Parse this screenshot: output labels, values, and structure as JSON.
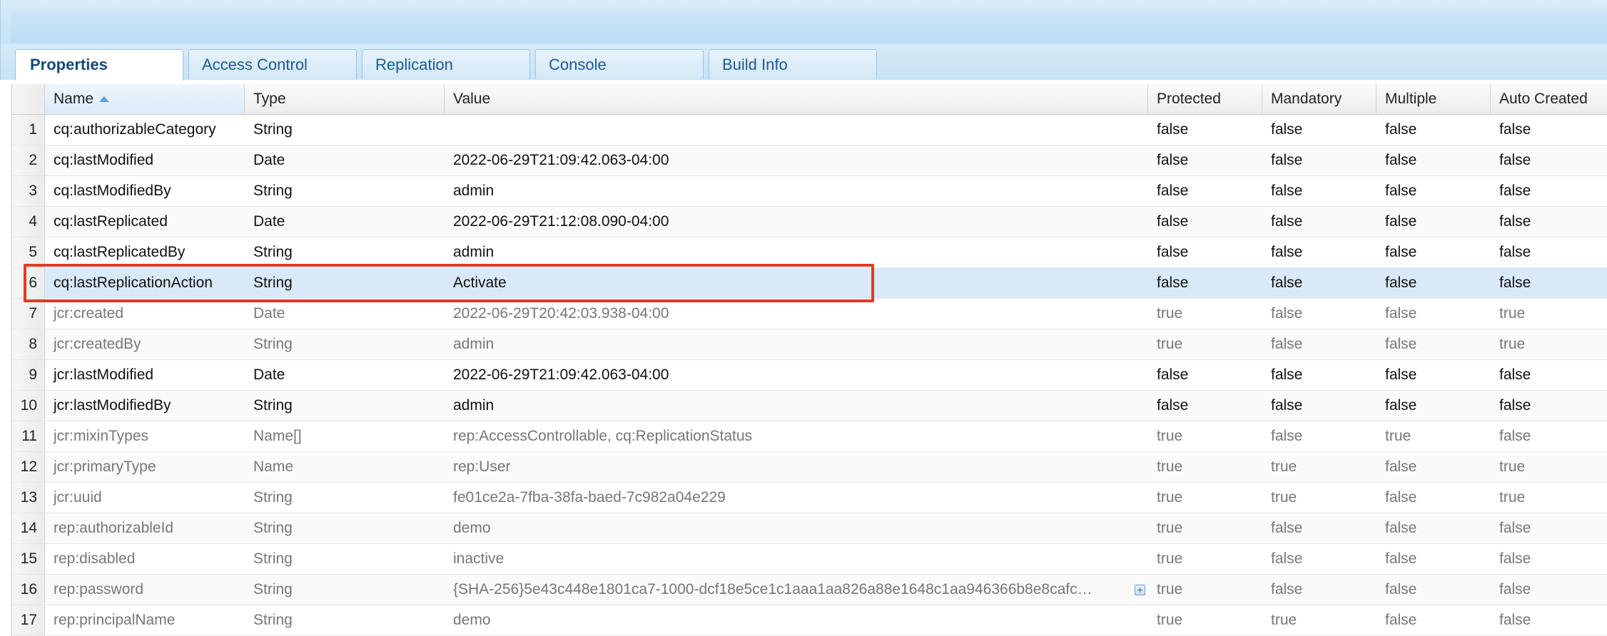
{
  "tabs": [
    {
      "label": "Properties",
      "active": true
    },
    {
      "label": "Access Control",
      "active": false
    },
    {
      "label": "Replication",
      "active": false
    },
    {
      "label": "Console",
      "active": false
    },
    {
      "label": "Build Info",
      "active": false
    }
  ],
  "columns": {
    "name": "Name",
    "type": "Type",
    "value": "Value",
    "protected": "Protected",
    "mandatory": "Mandatory",
    "multiple": "Multiple",
    "auto_created": "Auto Created"
  },
  "sort": {
    "column": "Name",
    "direction": "ascending"
  },
  "rows": [
    {
      "num": "1",
      "name": "cq:authorizableCategory",
      "type": "String",
      "value": "",
      "protected": "false",
      "mandatory": "false",
      "multiple": "false",
      "auto_created": "false"
    },
    {
      "num": "2",
      "name": "cq:lastModified",
      "type": "Date",
      "value": "2022-06-29T21:09:42.063-04:00",
      "protected": "false",
      "mandatory": "false",
      "multiple": "false",
      "auto_created": "false"
    },
    {
      "num": "3",
      "name": "cq:lastModifiedBy",
      "type": "String",
      "value": "admin",
      "protected": "false",
      "mandatory": "false",
      "multiple": "false",
      "auto_created": "false"
    },
    {
      "num": "4",
      "name": "cq:lastReplicated",
      "type": "Date",
      "value": "2022-06-29T21:12:08.090-04:00",
      "protected": "false",
      "mandatory": "false",
      "multiple": "false",
      "auto_created": "false"
    },
    {
      "num": "5",
      "name": "cq:lastReplicatedBy",
      "type": "String",
      "value": "admin",
      "protected": "false",
      "mandatory": "false",
      "multiple": "false",
      "auto_created": "false"
    },
    {
      "num": "6",
      "name": "cq:lastReplicationAction",
      "type": "String",
      "value": "Activate",
      "protected": "false",
      "mandatory": "false",
      "multiple": "false",
      "auto_created": "false"
    },
    {
      "num": "7",
      "name": "jcr:created",
      "type": "Date",
      "value": "2022-06-29T20:42:03.938-04:00",
      "protected": "true",
      "mandatory": "false",
      "multiple": "false",
      "auto_created": "true"
    },
    {
      "num": "8",
      "name": "jcr:createdBy",
      "type": "String",
      "value": "admin",
      "protected": "true",
      "mandatory": "false",
      "multiple": "false",
      "auto_created": "true"
    },
    {
      "num": "9",
      "name": "jcr:lastModified",
      "type": "Date",
      "value": "2022-06-29T21:09:42.063-04:00",
      "protected": "false",
      "mandatory": "false",
      "multiple": "false",
      "auto_created": "false"
    },
    {
      "num": "10",
      "name": "jcr:lastModifiedBy",
      "type": "String",
      "value": "admin",
      "protected": "false",
      "mandatory": "false",
      "multiple": "false",
      "auto_created": "false"
    },
    {
      "num": "11",
      "name": "jcr:mixinTypes",
      "type": "Name[]",
      "value": "rep:AccessControllable, cq:ReplicationStatus",
      "protected": "true",
      "mandatory": "false",
      "multiple": "true",
      "auto_created": "false"
    },
    {
      "num": "12",
      "name": "jcr:primaryType",
      "type": "Name",
      "value": "rep:User",
      "protected": "true",
      "mandatory": "true",
      "multiple": "false",
      "auto_created": "true"
    },
    {
      "num": "13",
      "name": "jcr:uuid",
      "type": "String",
      "value": "fe01ce2a-7fba-38fa-baed-7c982a04e229",
      "protected": "true",
      "mandatory": "true",
      "multiple": "false",
      "auto_created": "true"
    },
    {
      "num": "14",
      "name": "rep:authorizableId",
      "type": "String",
      "value": "demo",
      "protected": "true",
      "mandatory": "false",
      "multiple": "false",
      "auto_created": "false"
    },
    {
      "num": "15",
      "name": "rep:disabled",
      "type": "String",
      "value": "inactive",
      "protected": "true",
      "mandatory": "false",
      "multiple": "false",
      "auto_created": "false"
    },
    {
      "num": "16",
      "name": "rep:password",
      "type": "String",
      "value": "{SHA-256}5e43c448e1801ca7-1000-dcf18e5ce1c1aaa1aa826a88e1648c1aa946366b8e8cafc…",
      "protected": "true",
      "mandatory": "false",
      "multiple": "false",
      "auto_created": "false",
      "has_expand": true
    },
    {
      "num": "17",
      "name": "rep:principalName",
      "type": "String",
      "value": "demo",
      "protected": "true",
      "mandatory": "true",
      "multiple": "false",
      "auto_created": "false"
    }
  ],
  "selected_row": "6",
  "highlight_color": "#e03a2b",
  "accent_color": "#1c5a94"
}
